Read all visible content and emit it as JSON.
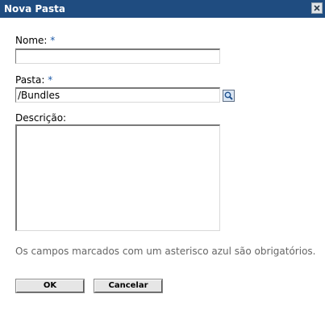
{
  "dialog": {
    "title": "Nova Pasta",
    "close_icon": "close-icon"
  },
  "form": {
    "name_label": "Nome:",
    "name_required_marker": "*",
    "name_value": "",
    "folder_label": "Pasta:",
    "folder_required_marker": "*",
    "folder_value": "/Bundles",
    "browse_icon": "magnifier-icon",
    "description_label": "Descrição:",
    "description_value": ""
  },
  "note": "Os campos marcados com um asterisco azul são obrigatórios.",
  "buttons": {
    "ok_label": "OK",
    "cancel_label": "Cancelar"
  },
  "colors": {
    "titlebar": "#1f4c80",
    "required_marker": "#1e5aa8",
    "note_text": "#666666"
  }
}
